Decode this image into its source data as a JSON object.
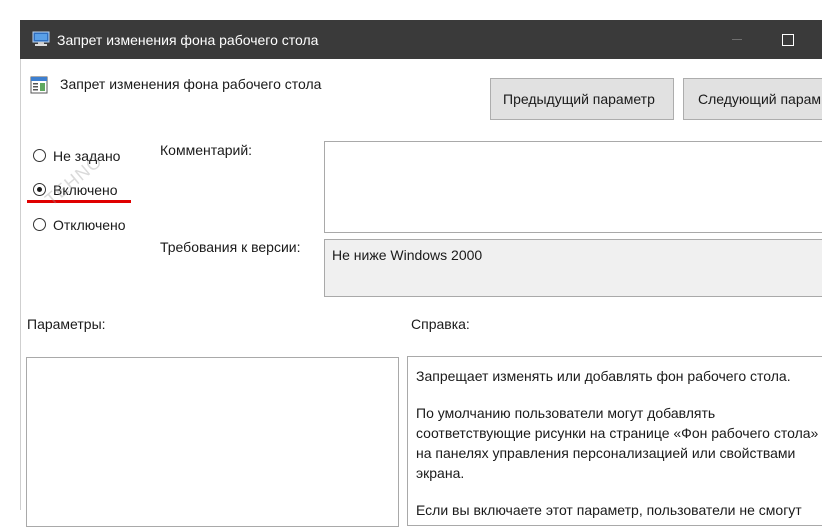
{
  "window": {
    "title": "Запрет изменения фона рабочего стола"
  },
  "policy": {
    "name": "Запрет изменения фона рабочего стола"
  },
  "buttons": {
    "previous": "Предыдущий параметр",
    "next": "Следующий парам"
  },
  "state": {
    "options": [
      {
        "label": "Не задано",
        "selected": false
      },
      {
        "label": "Включено",
        "selected": true
      },
      {
        "label": "Отключено",
        "selected": false
      }
    ]
  },
  "watermark": "TEHNO",
  "comment": {
    "label": "Комментарий:",
    "value": ""
  },
  "version": {
    "label": "Требования к версии:",
    "value": "Не ниже Windows 2000"
  },
  "sections": {
    "params_label": "Параметры:",
    "help_label": "Справка:"
  },
  "help": {
    "p1": "Запрещает изменять или добавлять фон рабочего стола.",
    "p2_lines": [
      "По умолчанию пользователи могут добавлять",
      "соответствующие рисунки на странице «Фон рабочего стола»",
      "на панелях управления персонализацией или свойствами",
      "экрана."
    ],
    "p3": "Если вы включаете этот параметр, пользователи не смогут"
  },
  "colors": {
    "titlebar": "#3a3a3a",
    "accent_mark": "#e00000"
  }
}
